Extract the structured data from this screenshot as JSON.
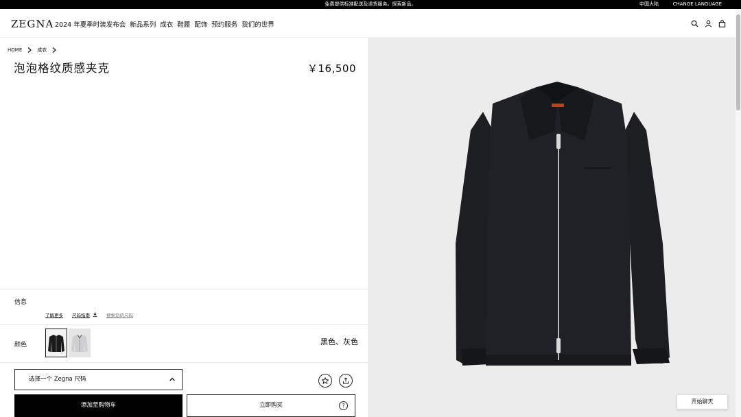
{
  "topbar": {
    "promo": "免费提供标准配送及退货服务。探索新品。",
    "region": "中国大陆",
    "language": "CHANGE LANGUAGE"
  },
  "nav": {
    "logo": "ZEGNA",
    "menu": [
      "2024 年夏季时装发布会",
      "新品系列",
      "成衣",
      "鞋履",
      "配饰",
      "预约服务",
      "我们的世界"
    ],
    "icons": [
      "search-icon",
      "user-icon",
      "bag-icon"
    ]
  },
  "breadcrumb": [
    "HOME",
    "成衣"
  ],
  "product": {
    "title": "泡泡格纹质感夹克",
    "price": "￥16,500"
  },
  "info": {
    "label": "信息",
    "links": [
      "了解更多",
      "尺码指南",
      "搜索您的尺码"
    ]
  },
  "colors": {
    "label": "颜色",
    "names": "黑色、灰色",
    "swatches": [
      "#1a1a1a",
      "#cfcfd2"
    ]
  },
  "actions": {
    "size_placeholder": "选择一个 Zegna 尺码",
    "add_to_cart": "添加至购物车",
    "buy_now": "立即购买",
    "help": "?"
  },
  "chat": {
    "label": "开始聊天"
  }
}
